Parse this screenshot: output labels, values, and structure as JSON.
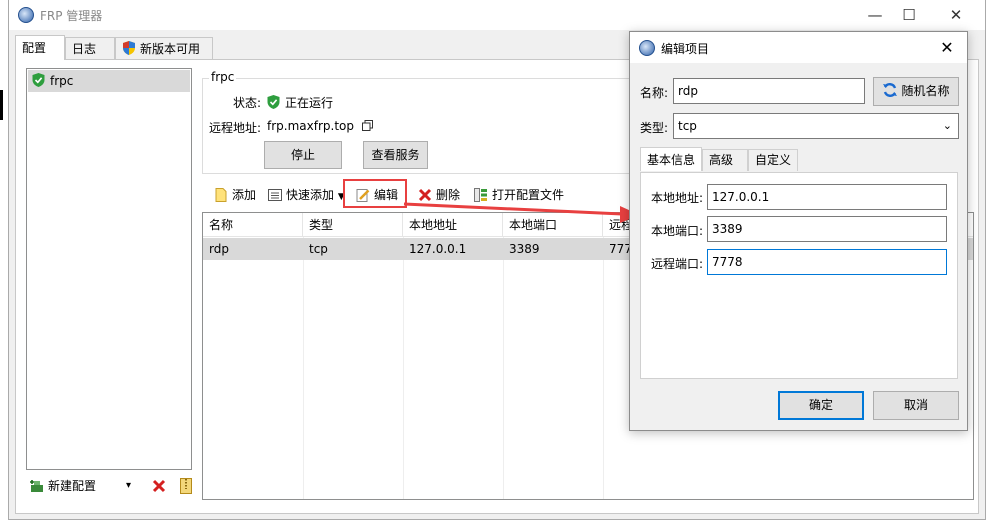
{
  "window": {
    "title": "FRP 管理器",
    "controls": {
      "minimize": "—",
      "maximize": "☐",
      "close": "✕"
    }
  },
  "tabs": [
    {
      "label": "配置",
      "active": true
    },
    {
      "label": "日志",
      "active": false
    },
    {
      "label": "新版本可用",
      "active": false
    }
  ],
  "config_list": {
    "items": [
      {
        "label": "frpc",
        "selected": true
      }
    ],
    "toolbar": {
      "new_label": "新建配置",
      "dropdown": "▾"
    }
  },
  "frpc_group": {
    "title": "frpc",
    "status_label": "状态:",
    "status_value": "正在运行",
    "remote_label": "远程地址:",
    "remote_value": "frp.maxfrp.top",
    "stop_button": "停止",
    "view_service_button": "查看服务"
  },
  "toolbar": {
    "add": "添加",
    "quick_add": "快速添加",
    "edit": "编辑",
    "delete": "删除",
    "open_file": "打开配置文件"
  },
  "proxy_table": {
    "columns": [
      "名称",
      "类型",
      "本地地址",
      "本地端口",
      "远程"
    ],
    "rows": [
      {
        "name": "rdp",
        "type": "tcp",
        "local_ip": "127.0.0.1",
        "local_port": "3389",
        "remote_port": "777"
      }
    ]
  },
  "dialog": {
    "title": "编辑项目",
    "close": "✕",
    "name_label": "名称:",
    "name_value": "rdp",
    "random_name_button": "随机名称",
    "type_label": "类型:",
    "type_value": "tcp",
    "tabs": [
      {
        "label": "基本信息",
        "active": true
      },
      {
        "label": "高级",
        "active": false
      },
      {
        "label": "自定义",
        "active": false
      }
    ],
    "local_ip_label": "本地地址:",
    "local_ip_value": "127.0.0.1",
    "local_port_label": "本地端口:",
    "local_port_value": "3389",
    "remote_port_label": "远程端口:",
    "remote_port_value": "7778",
    "ok_button": "确定",
    "cancel_button": "取消"
  },
  "colors": {
    "accent": "#0078d7",
    "highlight_red": "#e84040",
    "status_green": "#2e9e3e",
    "selection_gray": "#d9d9d9"
  }
}
